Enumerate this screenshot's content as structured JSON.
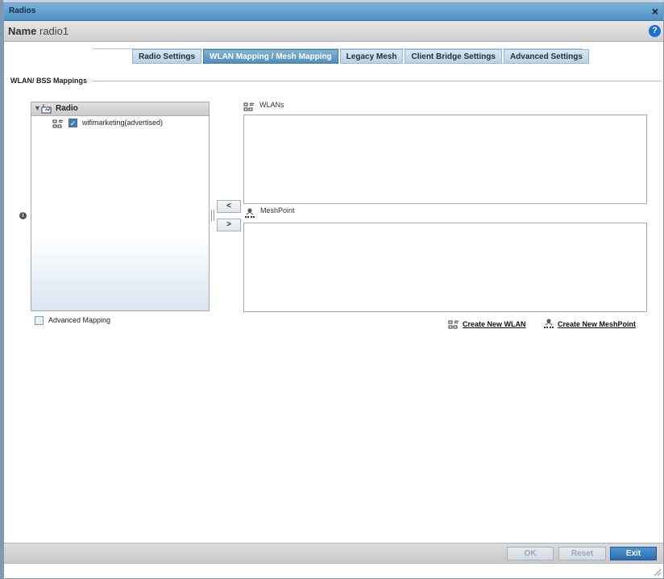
{
  "window": {
    "title": "Radios",
    "close_glyph": "×"
  },
  "name_bar": {
    "label": "Name",
    "value": "radio1",
    "help_glyph": "?"
  },
  "tabs": [
    {
      "label": "Radio Settings",
      "active": false
    },
    {
      "label": "WLAN Mapping / Mesh Mapping",
      "active": true
    },
    {
      "label": "Legacy Mesh",
      "active": false
    },
    {
      "label": "Client Bridge Settings",
      "active": false
    },
    {
      "label": "Advanced Settings",
      "active": false
    }
  ],
  "section": {
    "label": "WLAN/ BSS Mappings"
  },
  "tree": {
    "root_label": "Radio",
    "children": [
      {
        "label": "wifimarketing(advertised)",
        "checked": true
      }
    ]
  },
  "advanced_mapping": {
    "label": "Advanced Mapping",
    "checked": false
  },
  "move_buttons": {
    "left": "<",
    "right": ">"
  },
  "wlans_panel": {
    "title": "WLANs"
  },
  "meshpoint_panel": {
    "title": "MeshPoint"
  },
  "links": {
    "create_wlan": "Create New WLAN",
    "create_meshpoint": "Create New MeshPoint"
  },
  "footer": {
    "ok": "OK",
    "reset": "Reset",
    "exit": "Exit"
  },
  "colors": {
    "accent": "#2a6eb0",
    "titlebar": "#4e91c3",
    "tab_active": "#4f8fc0"
  },
  "icons": {
    "wlan": "wlan-icon",
    "meshpoint": "meshpoint-icon",
    "radio": "radio-icon",
    "info": "info-icon",
    "help": "help-icon"
  }
}
